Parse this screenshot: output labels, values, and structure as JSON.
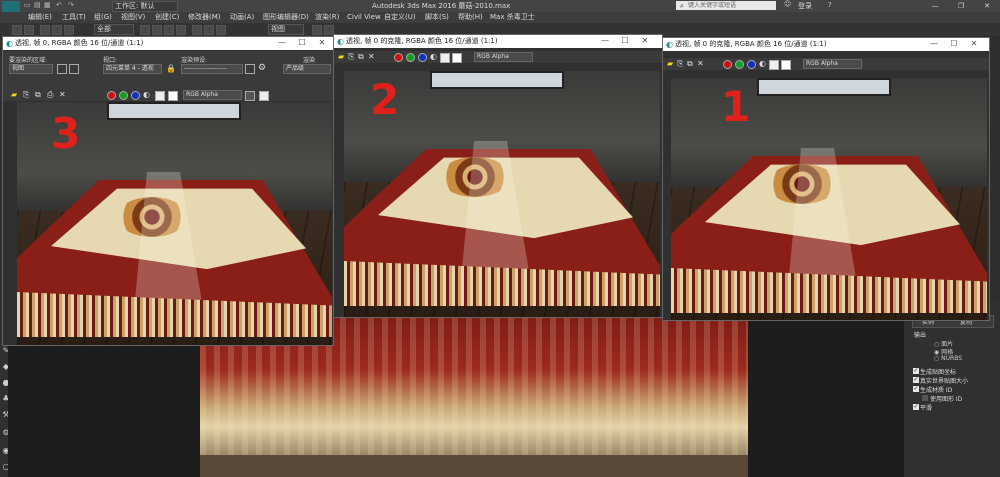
{
  "app": {
    "logo": "MAX",
    "title": "Autodesk 3ds Max 2016       蘑菇-2010.max",
    "workspace": "工作区: 默认",
    "search_placeholder": "键入关键字或短语",
    "login": "登录",
    "help": "?",
    "win_min": "—",
    "win_max": "❐",
    "win_close": "✕"
  },
  "menu": [
    "编辑(E)",
    "工具(T)",
    "组(G)",
    "视图(V)",
    "创建(C)",
    "修改器(M)",
    "动画(A)",
    "图形编辑器(D)",
    "渲染(R)",
    "Civil View",
    "自定义(U)",
    "脚本(S)",
    "帮助(H)",
    "Max 杀毒卫士"
  ],
  "toolbar": {
    "selection_filter": "全部",
    "view_dropdown": "视图"
  },
  "frame_windows": [
    {
      "title": "透视, 帧 0, RGBA 颜色 16 位/通道 (1:1)",
      "area_label": "要渲染的区域:",
      "area_value": "视图",
      "viewport_label": "视口:",
      "viewport_value": "四元菜单 4 - 透视",
      "preset_label": "渲染预设:",
      "preset_value": "--------------------",
      "render_label": "渲染",
      "render_value": "产品级",
      "channel": "RGB Alpha",
      "number": "3"
    },
    {
      "title": "透视, 帧 0 的克隆, RGBA 颜色 16 位/通道 (1:1)",
      "channel": "RGB Alpha",
      "number": "2"
    },
    {
      "title": "透视, 帧 0 的克隆, RGBA 颜色 16 位/通道 (1:1)",
      "channel": "RGB Alpha",
      "number": "1"
    }
  ],
  "right_panel": {
    "tabs": [
      "实例",
      "复制"
    ],
    "output_label": "输出",
    "radio_options": [
      "面片",
      "网格",
      "NURBS"
    ],
    "checks": [
      {
        "label": "生成贴图坐标",
        "checked": true
      },
      {
        "label": "真实世界贴图大小",
        "checked": true
      },
      {
        "label": "生成材质 ID",
        "checked": true
      },
      {
        "label": "使用图形 ID",
        "checked": false
      },
      {
        "label": "平滑",
        "checked": true
      }
    ]
  },
  "colors": {
    "accent": "#1f6f78",
    "annotation_red": "#e0201b"
  }
}
